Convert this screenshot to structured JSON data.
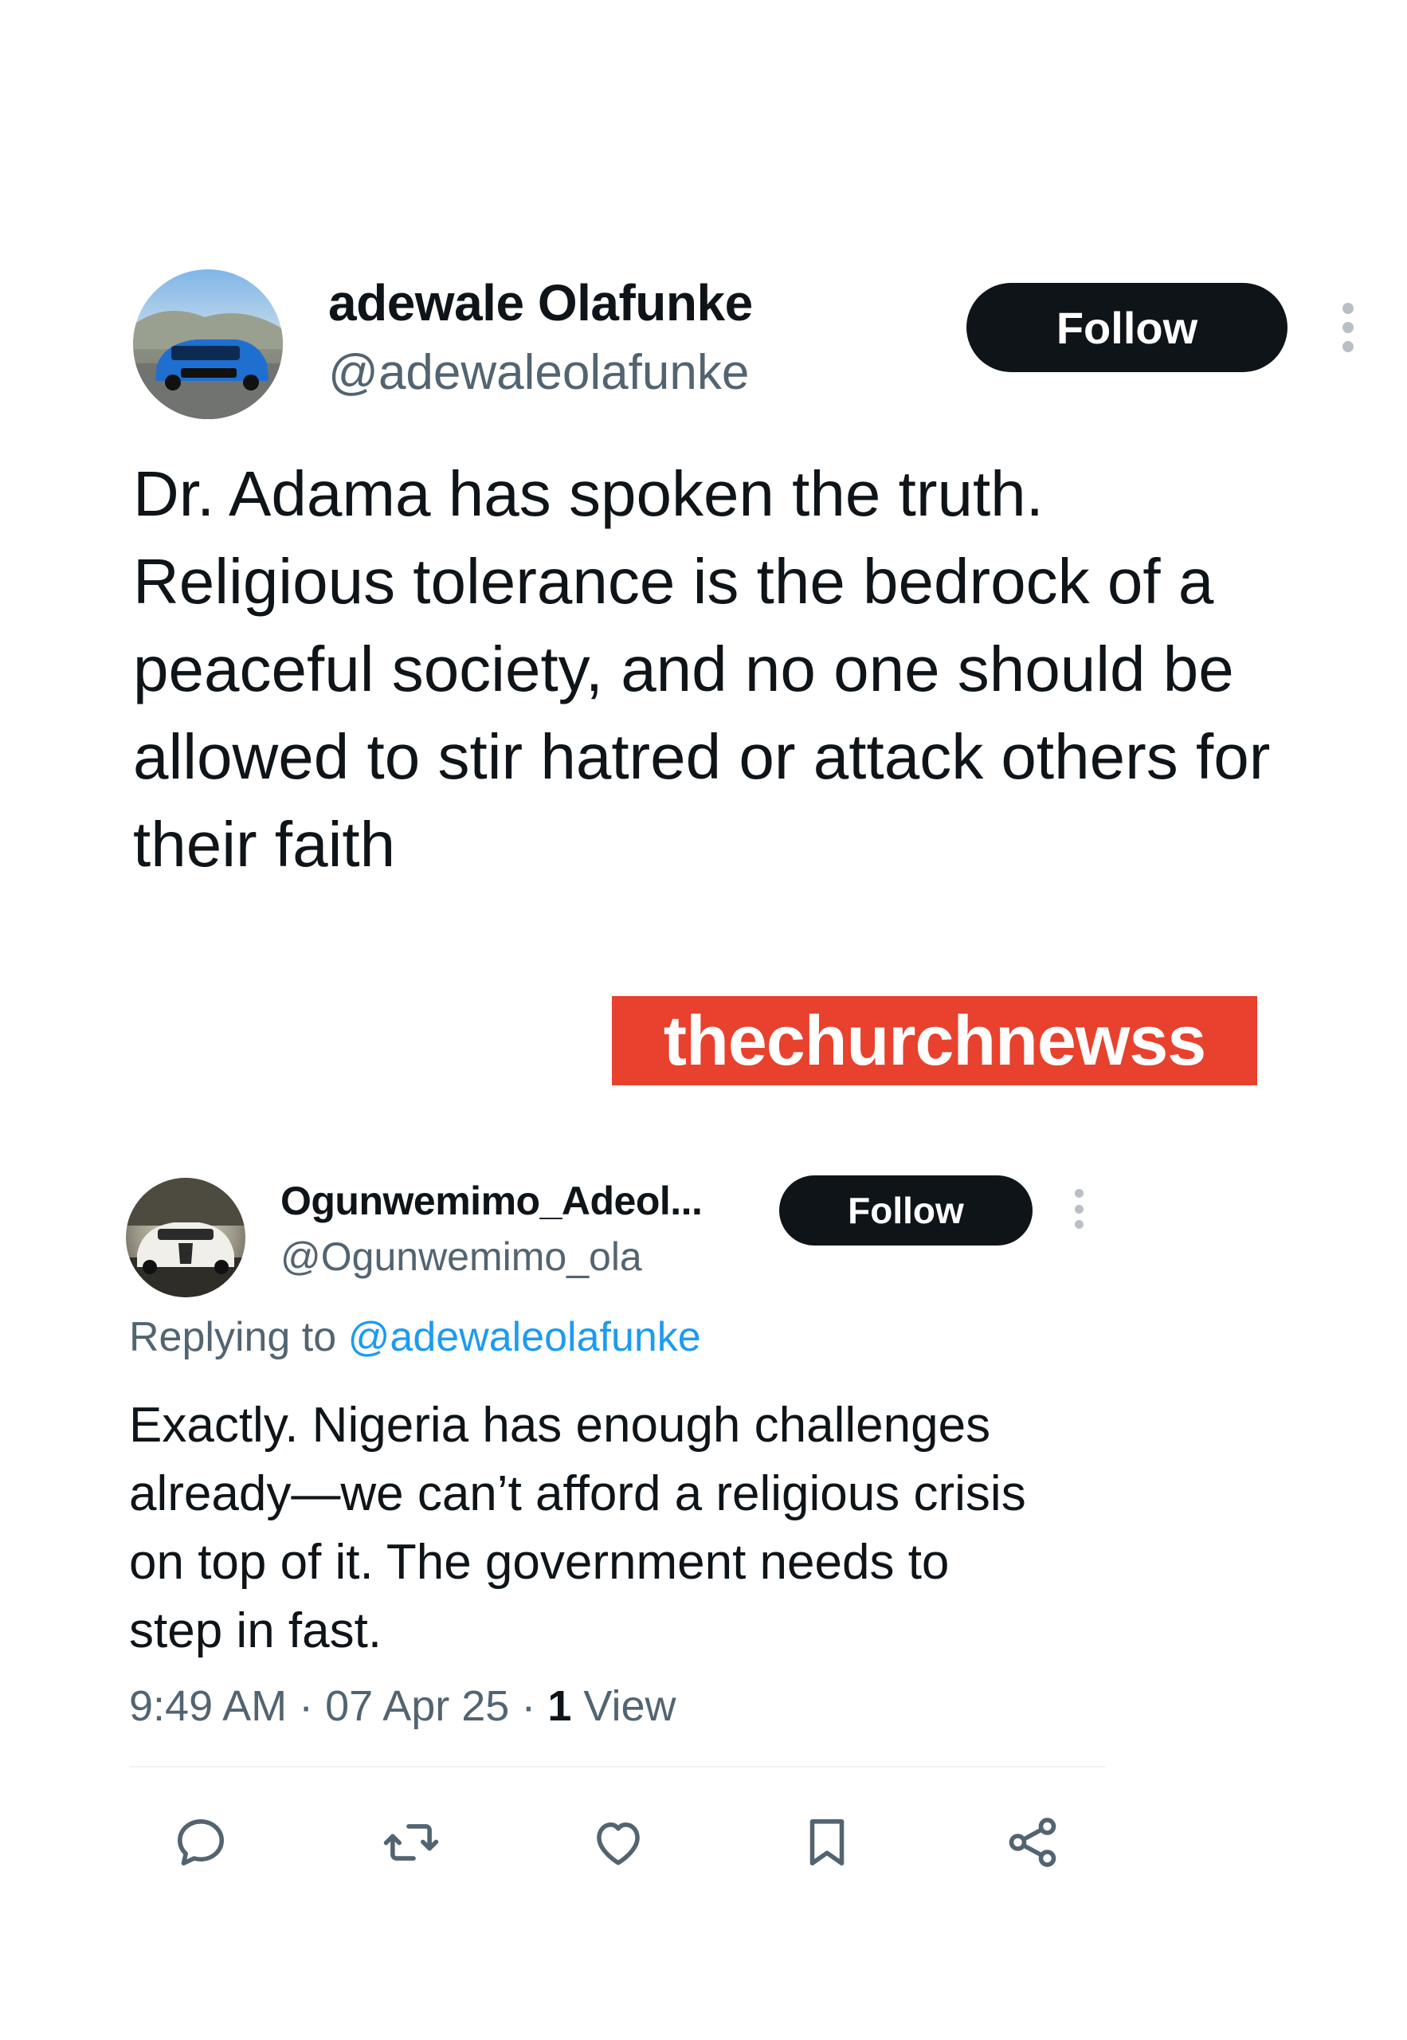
{
  "tweet": {
    "author_name": "adewale Olafunke",
    "author_handle": "@adewaleolafunke",
    "follow_label": "Follow",
    "text_lines": [
      "Dr. Adama has spoken the truth.",
      "Religious tolerance is the bedrock of a",
      "peaceful society, and no one should be",
      "allowed to stir hatred or attack others for",
      "their faith"
    ]
  },
  "watermark": {
    "text": "thechurchnewss",
    "color": "#e8412d"
  },
  "reply": {
    "author_name": "Ogunwemimo_Adeol...",
    "author_handle": "@Ogunwemimo_ola",
    "follow_label": "Follow",
    "replying_prefix": "Replying to",
    "replying_handle": "@adewaleolafunke",
    "text_lines": [
      "Exactly. Nigeria has enough challenges",
      "already—we can’t afford a religious crisis",
      "on top of it. The government needs to",
      "step in fast."
    ],
    "time": "9:49 AM",
    "date": "07 Apr 25",
    "separator": "·",
    "views_count": "1",
    "views_label": "View"
  },
  "actions": {
    "icons": [
      "reply-icon",
      "retweet-icon",
      "like-icon",
      "bookmark-icon",
      "share-icon"
    ]
  },
  "colors": {
    "text": "#0f1419",
    "secondary": "#536471",
    "link": "#1d9bf0",
    "button": "#0f1419"
  }
}
